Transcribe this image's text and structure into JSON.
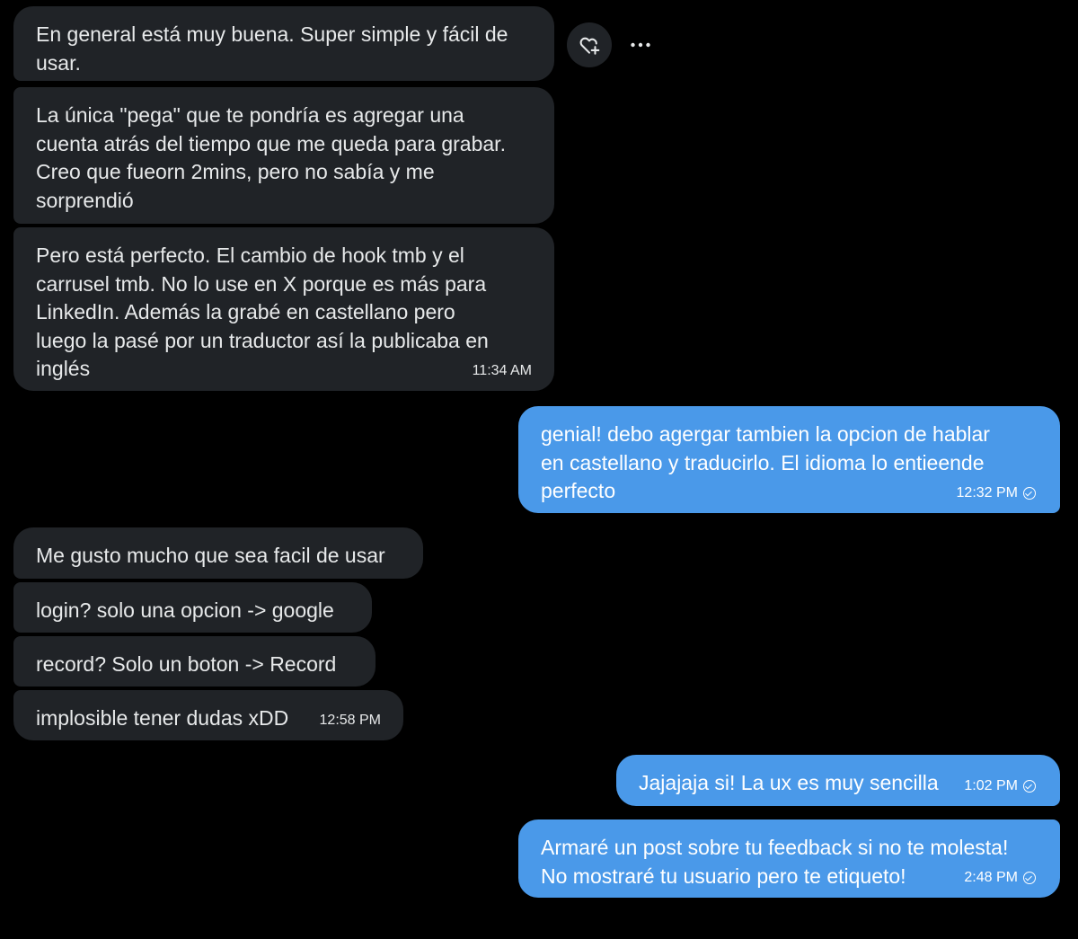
{
  "icons": {
    "react": "heart-plus-icon",
    "more": "more-horizontal-icon",
    "sent": "sent-check-icon"
  },
  "colors": {
    "background": "#000000",
    "incoming_bubble": "#202327",
    "outgoing_bubble": "#4a99e9"
  },
  "messages": [
    {
      "text": "En general está muy buena. Super simple y fácil de\nusar.",
      "time": ""
    },
    {
      "text": "La única \"pega\" que te pondría es agregar una\ncuenta atrás del tiempo que me queda para grabar.\nCreo que fueorn 2mins, pero no sabía y me\nsorprendió",
      "time": ""
    },
    {
      "text": "Pero está perfecto. El cambio de hook tmb y el\ncarrusel tmb. No lo use en X porque es más para\nLinkedIn. Además la grabé en castellano pero\nluego la pasé por un traductor así la publicaba en\ninglés",
      "time": "11:34 AM"
    },
    {
      "text": "genial! debo agergar tambien la opcion de hablar\nen castellano y traducirlo. El idioma lo entieende\nperfecto",
      "time": "12:32 PM"
    },
    {
      "text": "Me gusto mucho que sea facil de usar",
      "time": ""
    },
    {
      "text": "login? solo una opcion -> google",
      "time": ""
    },
    {
      "text": "record? Solo un boton -> Record",
      "time": ""
    },
    {
      "text": "implosible tener dudas xDD",
      "time": "12:58 PM"
    },
    {
      "text": "Jajajaja si! La ux es muy sencilla",
      "time": "1:02 PM"
    },
    {
      "text": "Armaré un post sobre tu feedback si no te molesta!\nNo mostraré tu usuario pero te etiqueto!",
      "time": "2:48 PM"
    }
  ]
}
